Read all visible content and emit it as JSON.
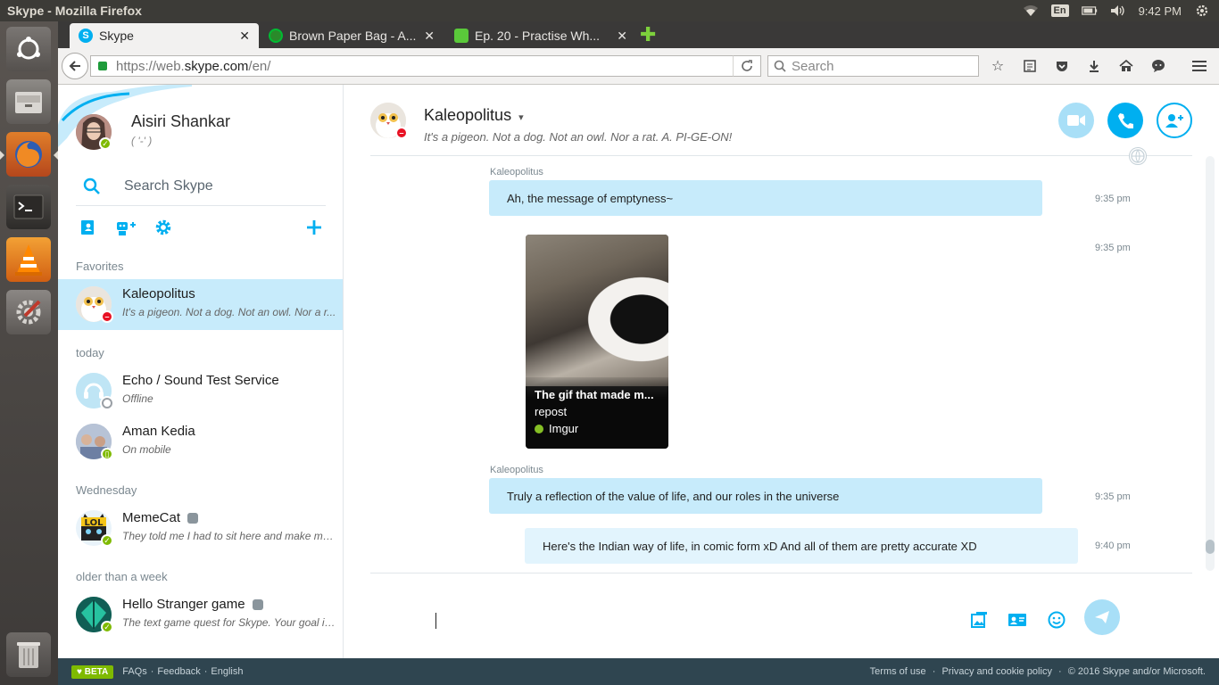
{
  "window": {
    "title": "Skype - Mozilla Firefox"
  },
  "panel": {
    "keyboard": "En",
    "time": "9:42 PM"
  },
  "launcher": {
    "items": [
      "ubuntu-icon",
      "files-icon",
      "firefox-icon",
      "terminal-icon",
      "vlc-icon",
      "settings-icon",
      "trash-icon"
    ]
  },
  "tabs": [
    {
      "label": "Skype",
      "active": true
    },
    {
      "label": "Brown Paper Bag - A...",
      "active": false
    },
    {
      "label": "Ep. 20 - Practise Wh...",
      "active": false
    }
  ],
  "nav": {
    "url_prefix": "https://web.",
    "url_domain": "skype.com",
    "url_suffix": "/en/",
    "search_placeholder": "Search"
  },
  "profile": {
    "name": "Aisiri Shankar",
    "mood": "( '-' )"
  },
  "sidebar": {
    "search_placeholder": "Search Skype",
    "sections": {
      "favorites": "Favorites",
      "today": "today",
      "wednesday": "Wednesday",
      "older": "older than a week"
    },
    "contacts": {
      "kaleo": {
        "name": "Kaleopolitus",
        "mood": "It's a pigeon. Not a dog. Not an owl. Nor a r..."
      },
      "echo": {
        "name": "Echo / Sound Test Service",
        "mood": "Offline"
      },
      "aman": {
        "name": "Aman Kedia",
        "mood": "On mobile"
      },
      "memecat": {
        "name": "MemeCat",
        "mood": "They told me I had to sit here and make me..."
      },
      "hello": {
        "name": "Hello Stranger game",
        "mood": "The text game quest for Skype. Your goal is t..."
      }
    }
  },
  "chat": {
    "name": "Kaleopolitus",
    "mood": "It's a pigeon. Not a dog. Not an owl. Nor a rat. A. PI-GE-ON!",
    "messages": {
      "m1": {
        "sender": "Kaleopolitus",
        "text": "Ah, the message of emptyness~",
        "time": "9:35 pm"
      },
      "m2": {
        "time": "9:35 pm",
        "card_title": "The gif that made m...",
        "card_desc": "repost",
        "card_source": "Imgur"
      },
      "m3": {
        "sender": "Kaleopolitus",
        "text": "Truly a reflection of the value of life, and our roles in the universe",
        "time": "9:35 pm"
      },
      "m4": {
        "text": "Here's the Indian way of life, in comic form xD And all of them are pretty accurate XD",
        "time": "9:40 pm"
      }
    }
  },
  "footer": {
    "beta": "♥ BETA",
    "faqs": "FAQs",
    "feedback": "Feedback",
    "language": "English",
    "terms": "Terms of use",
    "privacy": "Privacy and cookie policy",
    "copyright": "© 2016 Skype and/or Microsoft."
  },
  "colors": {
    "skype_blue": "#00aff0",
    "selected_bg": "#c7ebfb",
    "footer_bg": "#2f4550",
    "online": "#7fba00",
    "dnd": "#e81123"
  }
}
